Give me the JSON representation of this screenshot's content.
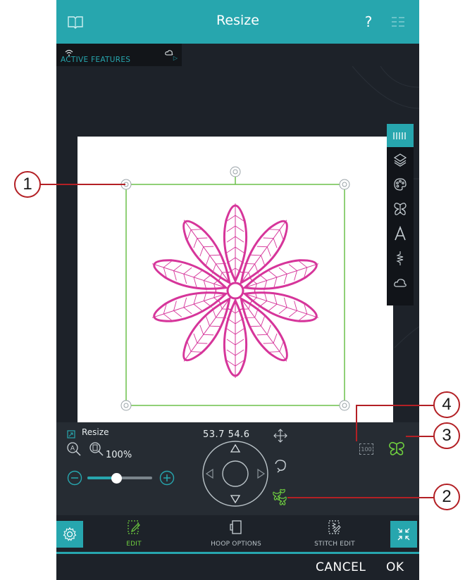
{
  "header": {
    "title": "Resize"
  },
  "active_features": {
    "label": "ACTIVE FEATURES"
  },
  "panel": {
    "title": "Resize",
    "coordinates": "53.7  54.6",
    "scale_label": "100%",
    "scale_slider_value": 0.45,
    "zoom_value": "100"
  },
  "tabs": [
    {
      "label": "EDIT"
    },
    {
      "label": "HOOP OPTIONS"
    },
    {
      "label": "STITCH EDIT"
    }
  ],
  "footer": {
    "cancel_label": "CANCEL",
    "ok_label": "OK"
  },
  "callouts": [
    "1",
    "2",
    "3",
    "4"
  ],
  "colors": {
    "accent": "#27a6ae",
    "design": "#d6359a",
    "selection": "#6cc04a",
    "callout": "#b32025"
  },
  "icons": {
    "topbar": [
      "book-icon",
      "help-icon",
      "menu-icon"
    ],
    "sidebar": [
      "thread-spool-icon",
      "layers-icon",
      "palette-icon",
      "butterfly-icon",
      "text-icon",
      "stitch-icon",
      "cloud-icon"
    ]
  }
}
